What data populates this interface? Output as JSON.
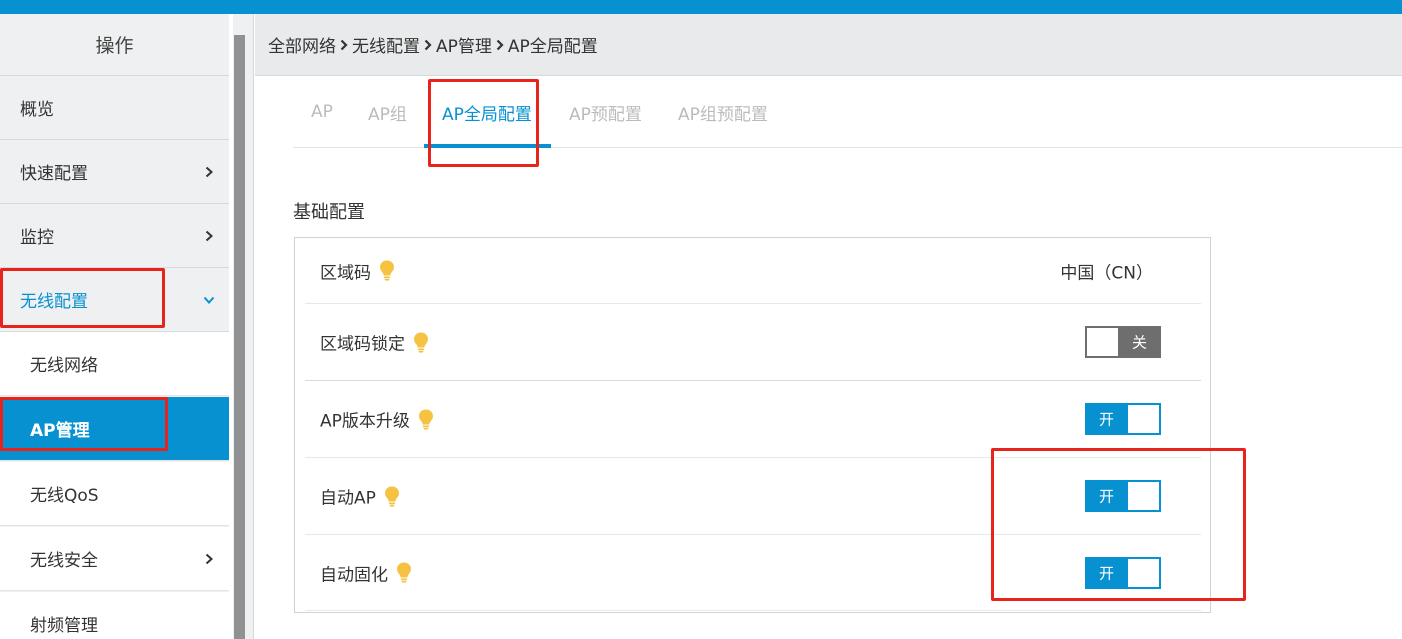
{
  "colors": {
    "accent": "#0891d1",
    "highlight": "#e8231c",
    "sidebar_bg": "#eef0f1",
    "bulb": "#f5c242",
    "toggle_off": "#6e6e6e"
  },
  "sidebar": {
    "header": "操作",
    "items": [
      {
        "label": "概览",
        "chevron": "none"
      },
      {
        "label": "快速配置",
        "chevron": "chevron-right-icon"
      },
      {
        "label": "监控",
        "chevron": "chevron-right-icon"
      },
      {
        "label": "无线配置",
        "chevron": "chevron-down-icon",
        "state": "expanded"
      },
      {
        "label": "无线网络",
        "chevron": "none",
        "sub": true
      },
      {
        "label": "AP管理",
        "chevron": "none",
        "sub": true,
        "state": "active"
      },
      {
        "label": "无线QoS",
        "chevron": "none",
        "sub": true
      },
      {
        "label": "无线安全",
        "chevron": "chevron-right-icon",
        "sub": true
      },
      {
        "label": "射频管理",
        "chevron": "none",
        "sub": true
      }
    ]
  },
  "breadcrumb": [
    "全部网络",
    "无线配置",
    "AP管理",
    "AP全局配置"
  ],
  "tabs": [
    {
      "label": "AP"
    },
    {
      "label": "AP组"
    },
    {
      "label": "AP全局配置",
      "active": true
    },
    {
      "label": "AP预配置"
    },
    {
      "label": "AP组预配置"
    }
  ],
  "section_title": "基础配置",
  "settings": [
    {
      "label": "区域码",
      "icon": "lightbulb-icon",
      "value": "中国（CN）"
    },
    {
      "label": "区域码锁定",
      "icon": "lightbulb-icon",
      "toggle": "off",
      "toggle_label": "关"
    },
    {
      "label": "AP版本升级",
      "icon": "lightbulb-icon",
      "toggle": "on",
      "toggle_label": "开"
    },
    {
      "label": "自动AP",
      "icon": "lightbulb-icon",
      "toggle": "on",
      "toggle_label": "开"
    },
    {
      "label": "自动固化",
      "icon": "lightbulb-icon",
      "toggle": "on",
      "toggle_label": "开"
    }
  ]
}
